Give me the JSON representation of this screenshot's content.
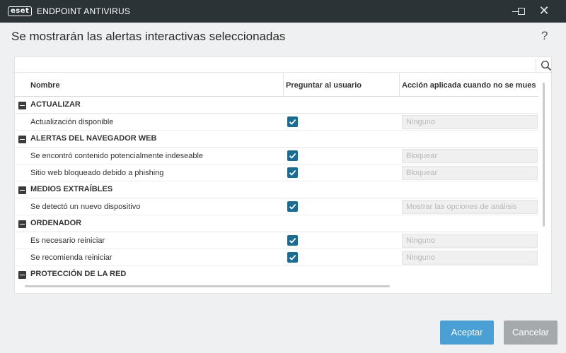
{
  "titlebar": {
    "logo_text": "eset",
    "app_title": "ENDPOINT ANTIVIRUS",
    "min_icon": "minimize-icon",
    "max_icon": "maximize-icon",
    "close_symbol": "✕"
  },
  "dialog": {
    "heading": "Se mostrarán las alertas interactivas seleccionadas",
    "help": "?"
  },
  "table": {
    "columns": [
      "Nombre",
      "Preguntar al usuario",
      "Acción aplicada cuando no se mues"
    ],
    "groups": [
      {
        "name": "ACTUALIZAR",
        "items": [
          {
            "name": "Actualización disponible",
            "ask": true,
            "action": "Ninguno"
          }
        ]
      },
      {
        "name": "ALERTAS DEL NAVEGADOR WEB",
        "items": [
          {
            "name": "Se encontró contenido potencialmente indeseable",
            "ask": true,
            "action": "Bloquear"
          },
          {
            "name": "Sitio web bloqueado debido a phishing",
            "ask": true,
            "action": "Bloquear"
          }
        ]
      },
      {
        "name": "MEDIOS EXTRAÍBLES",
        "items": [
          {
            "name": "Se detectó un nuevo dispositivo",
            "ask": true,
            "action": "Mostrar las opciones de análisis"
          }
        ]
      },
      {
        "name": "ORDENADOR",
        "items": [
          {
            "name": "Es necesario reiniciar",
            "ask": true,
            "action": "Ninguno"
          },
          {
            "name": "Se recomienda reiniciar",
            "ask": true,
            "action": "Ninguno"
          }
        ]
      },
      {
        "name": "PROTECCIÓN DE LA RED",
        "items": []
      }
    ]
  },
  "buttons": {
    "ok": "Aceptar",
    "cancel": "Cancelar"
  },
  "colors": {
    "titlebar": "#2c3337",
    "checkbox": "#1c6b91",
    "ok_button": "#4a9fd4",
    "cancel_button": "#a6a9ab"
  }
}
